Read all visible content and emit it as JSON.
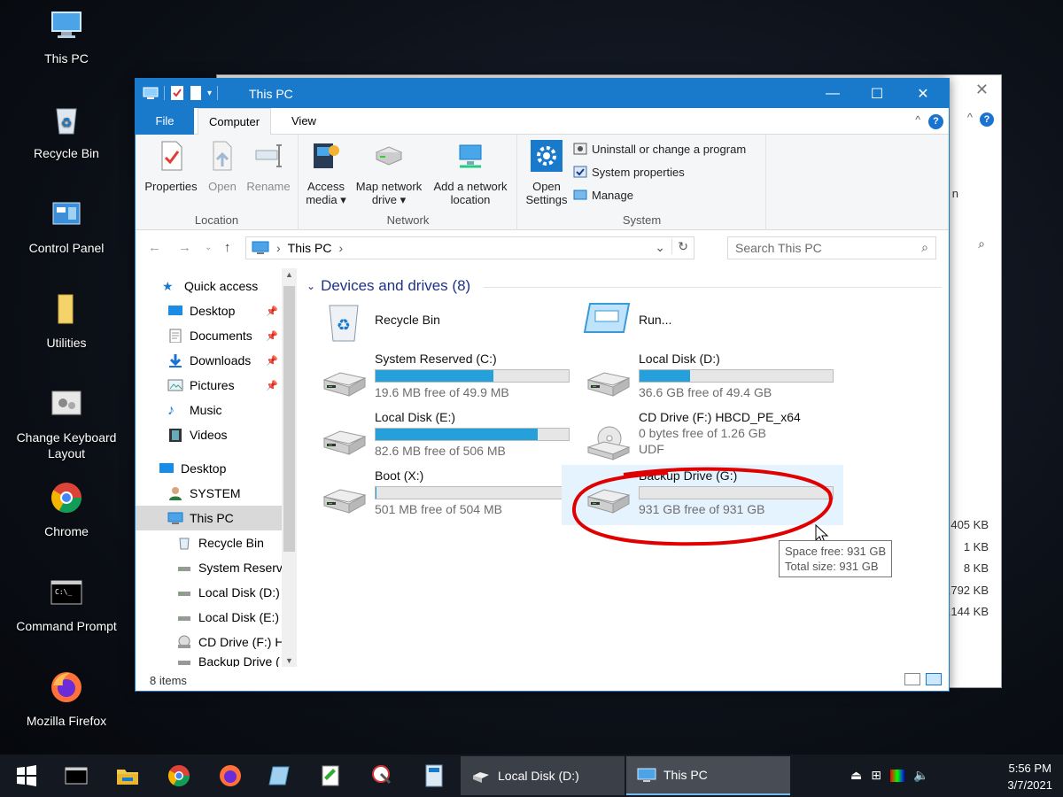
{
  "desktop": {
    "icons": [
      {
        "label": "This PC",
        "icon": "pc-icon"
      },
      {
        "label": "Recycle Bin",
        "icon": "recycle-bin-icon"
      },
      {
        "label": "Control Panel",
        "icon": "control-panel-icon"
      },
      {
        "label": "Utilities",
        "icon": "folder-icon"
      },
      {
        "label": "Change Keyboard Layout",
        "icon": "keyboard-settings-icon"
      },
      {
        "label": "Chrome",
        "icon": "chrome-icon"
      },
      {
        "label": "Command Prompt",
        "icon": "terminal-icon"
      },
      {
        "label": "Mozilla Firefox",
        "icon": "firefox-icon"
      }
    ]
  },
  "back_window": {
    "partial_text": "n",
    "sizes": [
      "405 KB",
      "1 KB",
      "8 KB",
      ",792 KB",
      ",144 KB"
    ]
  },
  "window": {
    "title": "This PC",
    "tabs": {
      "file": "File",
      "computer": "Computer",
      "view": "View"
    },
    "ribbon": {
      "location": {
        "name": "Location",
        "buttons": [
          "Properties",
          "Open",
          "Rename"
        ]
      },
      "network": {
        "name": "Network",
        "access_media": "Access media",
        "map_drive": "Map network drive",
        "add_location": "Add a network location"
      },
      "system": {
        "name": "System",
        "open_settings": "Open Settings",
        "uninstall": "Uninstall or change a program",
        "system_properties": "System properties",
        "manage": "Manage"
      }
    },
    "address": {
      "path": "This PC",
      "search_placeholder": "Search This PC"
    },
    "nav_pane": [
      {
        "label": "Quick access",
        "indent": 0,
        "pinned": false,
        "icon": "star-icon"
      },
      {
        "label": "Desktop",
        "indent": 1,
        "pinned": true,
        "icon": "desktop-icon"
      },
      {
        "label": "Documents",
        "indent": 1,
        "pinned": true,
        "icon": "documents-icon"
      },
      {
        "label": "Downloads",
        "indent": 1,
        "pinned": true,
        "icon": "downloads-icon"
      },
      {
        "label": "Pictures",
        "indent": 1,
        "pinned": true,
        "icon": "pictures-icon"
      },
      {
        "label": "Music",
        "indent": 1,
        "pinned": false,
        "icon": "music-icon"
      },
      {
        "label": "Videos",
        "indent": 1,
        "pinned": false,
        "icon": "videos-icon"
      },
      {
        "label": "Desktop",
        "indent": 0,
        "pinned": false,
        "icon": "desktop-icon"
      },
      {
        "label": "SYSTEM",
        "indent": 1,
        "pinned": false,
        "icon": "user-icon"
      },
      {
        "label": "This PC",
        "indent": 1,
        "pinned": false,
        "icon": "pc-icon",
        "selected": true
      },
      {
        "label": "Recycle Bin",
        "indent": 2,
        "pinned": false,
        "icon": "recycle-bin-icon"
      },
      {
        "label": "System Reserve",
        "indent": 2,
        "pinned": false,
        "icon": "drive-icon"
      },
      {
        "label": "Local Disk (D:)",
        "indent": 2,
        "pinned": false,
        "icon": "drive-icon"
      },
      {
        "label": "Local Disk (E:)",
        "indent": 2,
        "pinned": false,
        "icon": "drive-icon"
      },
      {
        "label": "CD Drive (F:) H",
        "indent": 2,
        "pinned": false,
        "icon": "cd-icon"
      },
      {
        "label": "Backup Drive (",
        "indent": 2,
        "pinned": false,
        "icon": "drive-icon"
      }
    ],
    "section_title": "Devices and drives (8)",
    "items": [
      {
        "name": "Recycle Bin",
        "kind": "bin"
      },
      {
        "name": "Run...",
        "kind": "run"
      },
      {
        "name": "System Reserved (C:)",
        "free": "19.6 MB free of 49.9 MB",
        "used_fraction": 0.61,
        "kind": "drive"
      },
      {
        "name": "Local Disk (D:)",
        "free": "36.6 GB free of 49.4 GB",
        "used_fraction": 0.26,
        "kind": "drive"
      },
      {
        "name": "Local Disk (E:)",
        "free": "82.6 MB free of 506 MB",
        "used_fraction": 0.84,
        "kind": "drive"
      },
      {
        "name": "CD Drive (F:) HBCD_PE_x64",
        "free": "0 bytes free of 1.26 GB",
        "extra": "UDF",
        "kind": "cd"
      },
      {
        "name": "Boot (X:)",
        "free": "501 MB free of 504 MB",
        "used_fraction": 0.006,
        "kind": "drive"
      },
      {
        "name": "Backup Drive (G:)",
        "free": "931 GB free of 931 GB",
        "used_fraction": 0.0,
        "kind": "drive",
        "hover": true
      }
    ],
    "tooltip": {
      "line1": "Space free: 931 GB",
      "line2": "Total size: 931 GB"
    },
    "status": "8 items"
  },
  "taskbar": {
    "tasks": [
      {
        "label": "Local Disk (D:)"
      },
      {
        "label": "This PC",
        "active": true
      }
    ],
    "time": "5:56 PM",
    "date": "3/7/2021"
  },
  "colors": {
    "accent": "#1979ca",
    "bar": "#26a0da",
    "annotation": "#e00000"
  }
}
